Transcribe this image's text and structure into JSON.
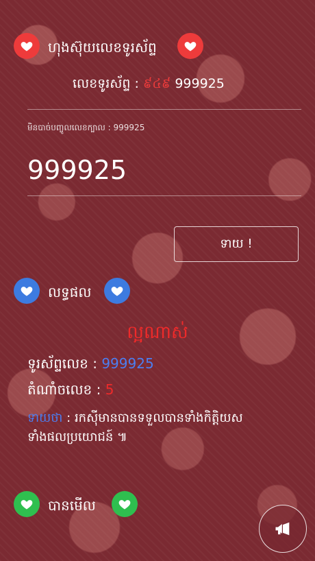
{
  "header": {
    "title": "ហុងស៊ុយលេខទូរស័ព្ទ",
    "phone_label": "លេខទូរស័ព្ទ :",
    "phone_prefix": "៩៤៩",
    "phone_number": "999925"
  },
  "input": {
    "hint": "មិនបាច់បញ្ចូលលេខក្បាល : 999925",
    "value": "999925"
  },
  "submit_label": "ទាយ !",
  "result": {
    "title": "លទ្ធផល",
    "verdict": "ល្អណាស់",
    "number_label": "ទូរស័ព្ទលេខ :",
    "number_value": "999925",
    "score_label": "តំណាំចលេខ :",
    "score_value": "5",
    "meaning_label": "ទាយថា",
    "meaning_line1": ": រកស៊ីមានបានទទួលបានទាំងកិត្តិយស",
    "meaning_line2": "ទាំងផលប្រយោជន៍ ៕"
  },
  "viewed": {
    "title": "បានមើល"
  },
  "colors": {
    "accent_red": "#ee3b3b",
    "accent_blue": "#3d7be0",
    "accent_green": "#2fbf4f",
    "number_blue": "#4c7ef0",
    "verdict_red": "#ee2a2a"
  },
  "icons": {
    "heart": "heart-icon",
    "megaphone": "megaphone-icon"
  }
}
